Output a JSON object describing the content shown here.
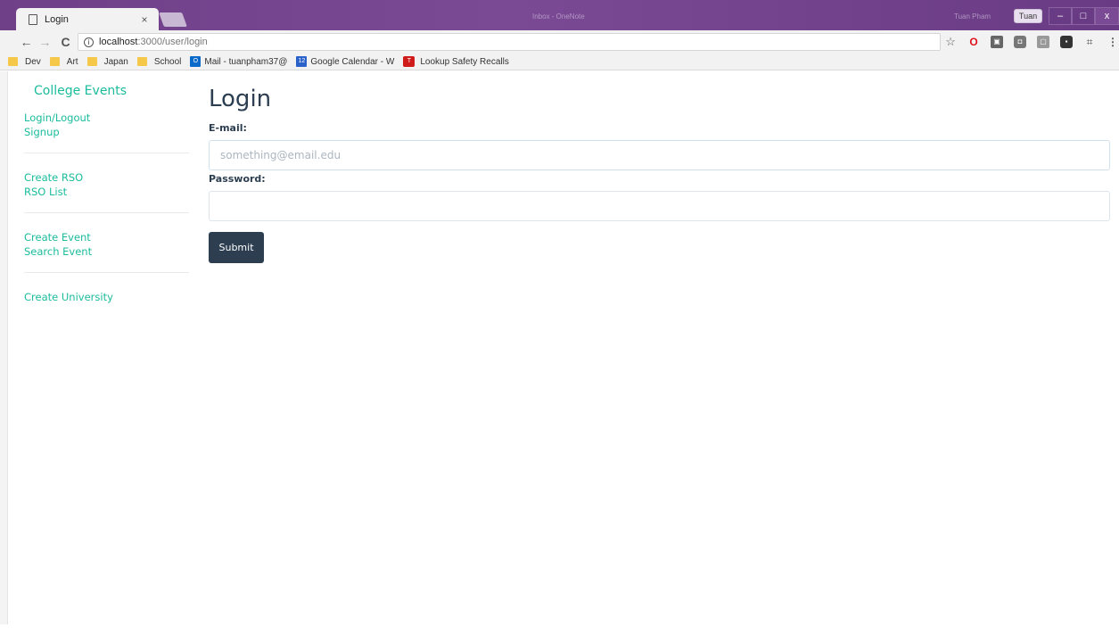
{
  "browser": {
    "tab_title": "Login",
    "tab_close": "×",
    "titlebar_center": "Inbox - OneNote",
    "titlebar_right": "Tuan Pham",
    "profile": "Tuan",
    "win_min": "–",
    "win_max": "□",
    "win_close": "x",
    "url_host": "localhost",
    "url_path": ":3000/user/login",
    "bookmarks": [
      {
        "label": "Dev"
      },
      {
        "label": "Art"
      },
      {
        "label": "Japan"
      },
      {
        "label": "School"
      },
      {
        "label": "Mail - tuanpham37@"
      },
      {
        "label": "Google Calendar - W"
      },
      {
        "label": "Lookup Safety Recalls"
      }
    ]
  },
  "sidebar": {
    "brand": "College Events",
    "groups": [
      [
        "Login/Logout",
        "Signup"
      ],
      [
        "Create RSO",
        "RSO List"
      ],
      [
        "Create Event",
        "Search Event"
      ],
      [
        "Create University"
      ]
    ]
  },
  "form": {
    "title": "Login",
    "email_label": "E-mail:",
    "email_placeholder": "something@email.edu",
    "email_value": "",
    "password_label": "Password:",
    "password_value": "",
    "submit_label": "Submit"
  },
  "colors": {
    "accent": "#1abc9c",
    "primary": "#2c3e50",
    "titlebar": "#6f3f88"
  }
}
